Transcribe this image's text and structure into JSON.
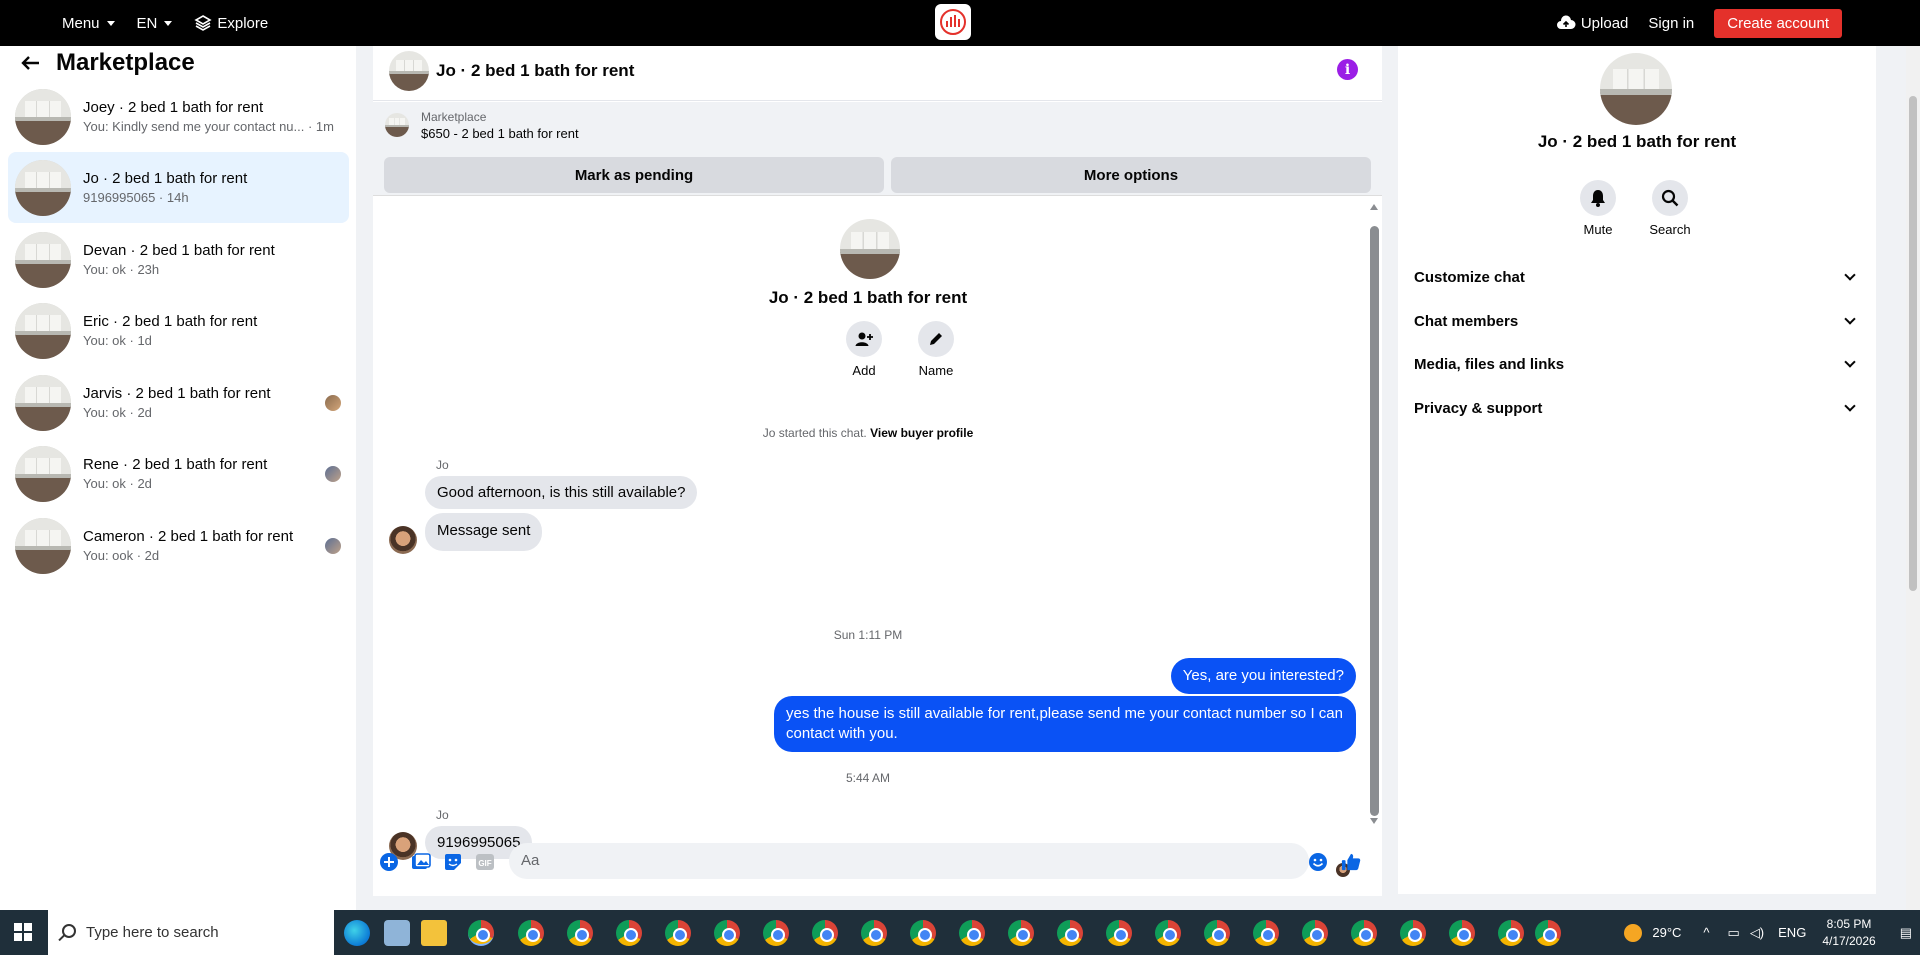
{
  "topbar": {
    "menu": "Menu",
    "lang": "EN",
    "explore": "Explore",
    "upload": "Upload",
    "sign_in": "Sign in",
    "create_account": "Create account",
    "accent": "#e4312b"
  },
  "sidebar": {
    "title": "Marketplace",
    "conversations": [
      {
        "name": "Joey · 2 bed 1 bath for rent",
        "sub": "You: Kindly send me your contact nu... · 1m"
      },
      {
        "name": "Jo · 2 bed 1 bath for rent",
        "sub": "9196995065 · 14h"
      },
      {
        "name": "Devan · 2 bed 1 bath for rent",
        "sub": "You: ok · 23h"
      },
      {
        "name": "Eric · 2 bed 1 bath for rent",
        "sub": "You: ok · 1d"
      },
      {
        "name": "Jarvis · 2 bed 1 bath for rent",
        "sub": "You: ok · 2d"
      },
      {
        "name": "Rene · 2 bed 1 bath for rent",
        "sub": "You: ok · 2d"
      },
      {
        "name": "Cameron · 2 bed 1 bath for rent",
        "sub": "You: ook · 2d"
      }
    ]
  },
  "chat": {
    "title": "Jo · 2 bed 1 bath for rent",
    "marketplace_label": "Marketplace",
    "listing": "$650 - 2 bed 1 bath for rent",
    "mark_pending": "Mark as pending",
    "more_options": "More options",
    "center_title": "Jo · 2 bed 1 bath for rent",
    "add_label": "Add",
    "name_label": "Name",
    "started_text": "Jo started this chat.",
    "view_profile": "View buyer profile",
    "sender": "Jo",
    "msg_in_1": "Good afternoon, is this still available?",
    "msg_in_2": "Message sent",
    "time_1": "Sun 1:11 PM",
    "msg_out_1": "Yes, are you interested?",
    "msg_out_2": "yes the house is still available for rent,please send me your contact number so I can contact with you.",
    "time_2": "5:44 AM",
    "msg_in_3": "9196995065",
    "composer_placeholder": "Aa",
    "accent": "#0a52f5"
  },
  "right_panel": {
    "title": "Jo · 2 bed 1 bath for rent",
    "mute": "Mute",
    "search": "Search",
    "sections": [
      "Customize chat",
      "Chat members",
      "Media, files and links",
      "Privacy & support"
    ]
  },
  "taskbar": {
    "search_placeholder": "Type here to search",
    "temperature": "29°C",
    "lang": "ENG",
    "time": "8:05 PM",
    "date": "4/17/2026"
  }
}
